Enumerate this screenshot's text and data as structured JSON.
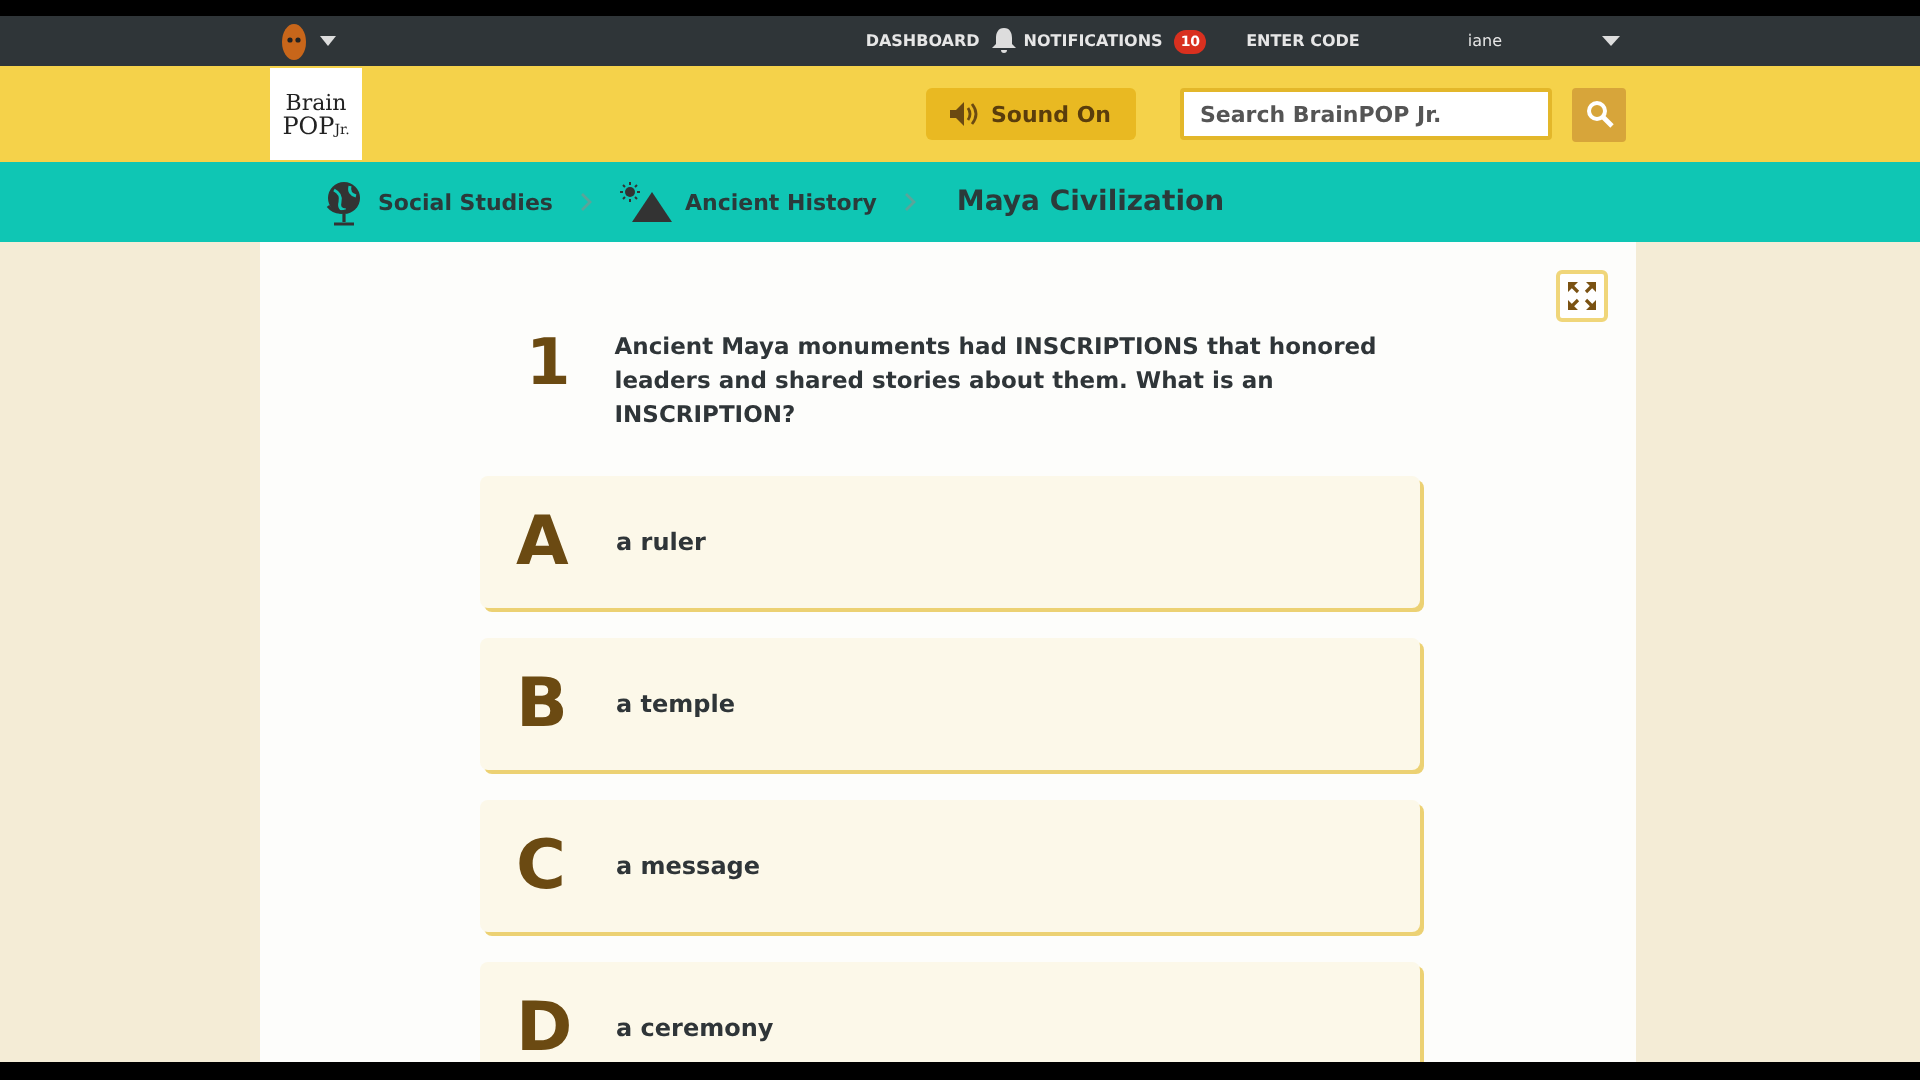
{
  "top_nav": {
    "links": [
      "DASHBOARD",
      "NOTIFICATIONS",
      "ENTER CODE"
    ],
    "notification_count": "10",
    "user": "iane"
  },
  "header": {
    "logo": {
      "line_1": "Brain",
      "line_2": "POP",
      "line_3": "Jr."
    },
    "sound_button": "Sound On",
    "search": {
      "placeholder": "Search BrainPOP Jr."
    }
  },
  "breadcrumb": [
    {
      "label": "Social Studies",
      "kind": "globe"
    },
    {
      "label": "Ancient History",
      "kind": "pyramid"
    },
    {
      "label": "Maya Civilization",
      "kind": "current"
    }
  ],
  "question": {
    "number": "1",
    "text": "Ancient Maya monuments had INSCRIPTIONS that honored leaders and shared stories about them. What is an INSCRIPTION?"
  },
  "choices": [
    {
      "letter": "A",
      "text": "a ruler"
    },
    {
      "letter": "B",
      "text": "a temple"
    },
    {
      "letter": "C",
      "text": "a message"
    },
    {
      "letter": "D",
      "text": "a ceremony"
    }
  ]
}
